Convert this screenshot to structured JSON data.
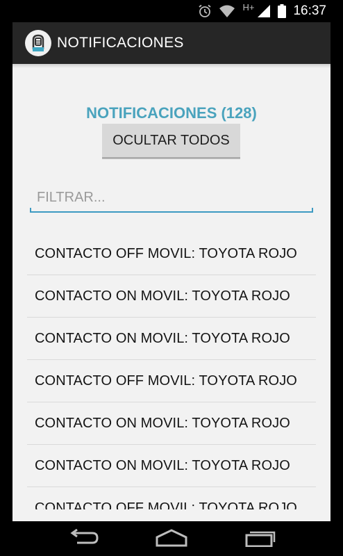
{
  "status_bar": {
    "time": "16:37",
    "network_label": "H+",
    "icons": [
      "alarm-icon",
      "wifi-icon",
      "cell-signal-icon",
      "battery-icon"
    ]
  },
  "action_bar": {
    "title": "NOTIFICACIONES",
    "icon": "app-logo-icon"
  },
  "main": {
    "heading": "NOTIFICACIONES (128)",
    "hide_all_label": "OCULTAR TODOS",
    "filter": {
      "placeholder": "FILTRAR...",
      "value": ""
    },
    "notifications": [
      "CONTACTO OFF MOVIL: TOYOTA ROJO",
      "CONTACTO ON MOVIL: TOYOTA ROJO",
      "CONTACTO ON MOVIL: TOYOTA ROJO",
      "CONTACTO OFF MOVIL: TOYOTA ROJO",
      "CONTACTO ON MOVIL: TOYOTA ROJO",
      "CONTACTO ON MOVIL: TOYOTA ROJO",
      "CONTACTO OFF MOVIL: TOYOTA ROJO"
    ]
  },
  "nav_bar": {
    "buttons": [
      "back-icon",
      "home-icon",
      "recent-apps-icon"
    ]
  },
  "colors": {
    "accent": "#4aa3bd",
    "input_underline": "#3d9ac2",
    "action_bar": "#262626",
    "background": "#f2f2f2"
  }
}
